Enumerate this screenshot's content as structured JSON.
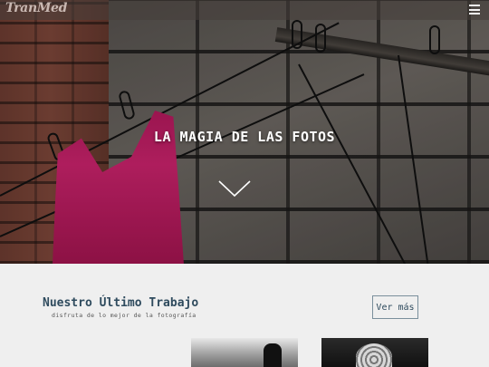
{
  "navbar": {
    "logo_text": "TranMed",
    "menu_icon": "hamburger-menu-icon"
  },
  "hero": {
    "title": "LA MAGIA DE LAS FOTOS",
    "scroll_icon": "chevron-down-icon"
  },
  "work_section": {
    "title": "Nuestro Último Trabajo",
    "subtitle": "disfruta de lo mejor de la fotografía",
    "more_button_label": "Ver más"
  },
  "colors": {
    "heading": "#2f4b5e",
    "section_background": "#efefef",
    "accent_pink": "#c6226a"
  }
}
